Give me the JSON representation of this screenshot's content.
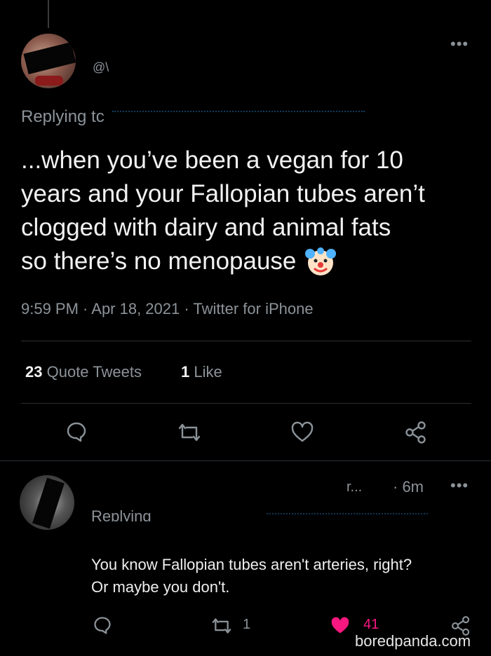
{
  "tweet": {
    "handle_fragment": "@\\",
    "replying_to": "Replying tc",
    "text_lines": [
      "...when you’ve been a vegan for 10",
      "years and your Fallopian tubes aren’t",
      "clogged with dairy and animal fats",
      "so there’s no menopause"
    ],
    "emoji": "🤡",
    "timestamp": "9:59 PM · Apr 18, 2021 · Twitter for iPhone",
    "quote_count": "23",
    "quote_label": "Quote Tweets",
    "like_count": "1",
    "like_label": "Like"
  },
  "reply": {
    "name_fragment": "r...",
    "time": "· 6m",
    "replying_label": "Replying",
    "text_lines": [
      "You know Fallopian tubes aren't arteries, right?",
      "Or maybe you don't."
    ],
    "retweet_count": "1",
    "like_count": "41"
  },
  "watermark": "boredpanda.com",
  "colors": {
    "background": "#000000",
    "text": "#e7e9ea",
    "muted": "#8b9399",
    "like_red": "#f91880"
  }
}
